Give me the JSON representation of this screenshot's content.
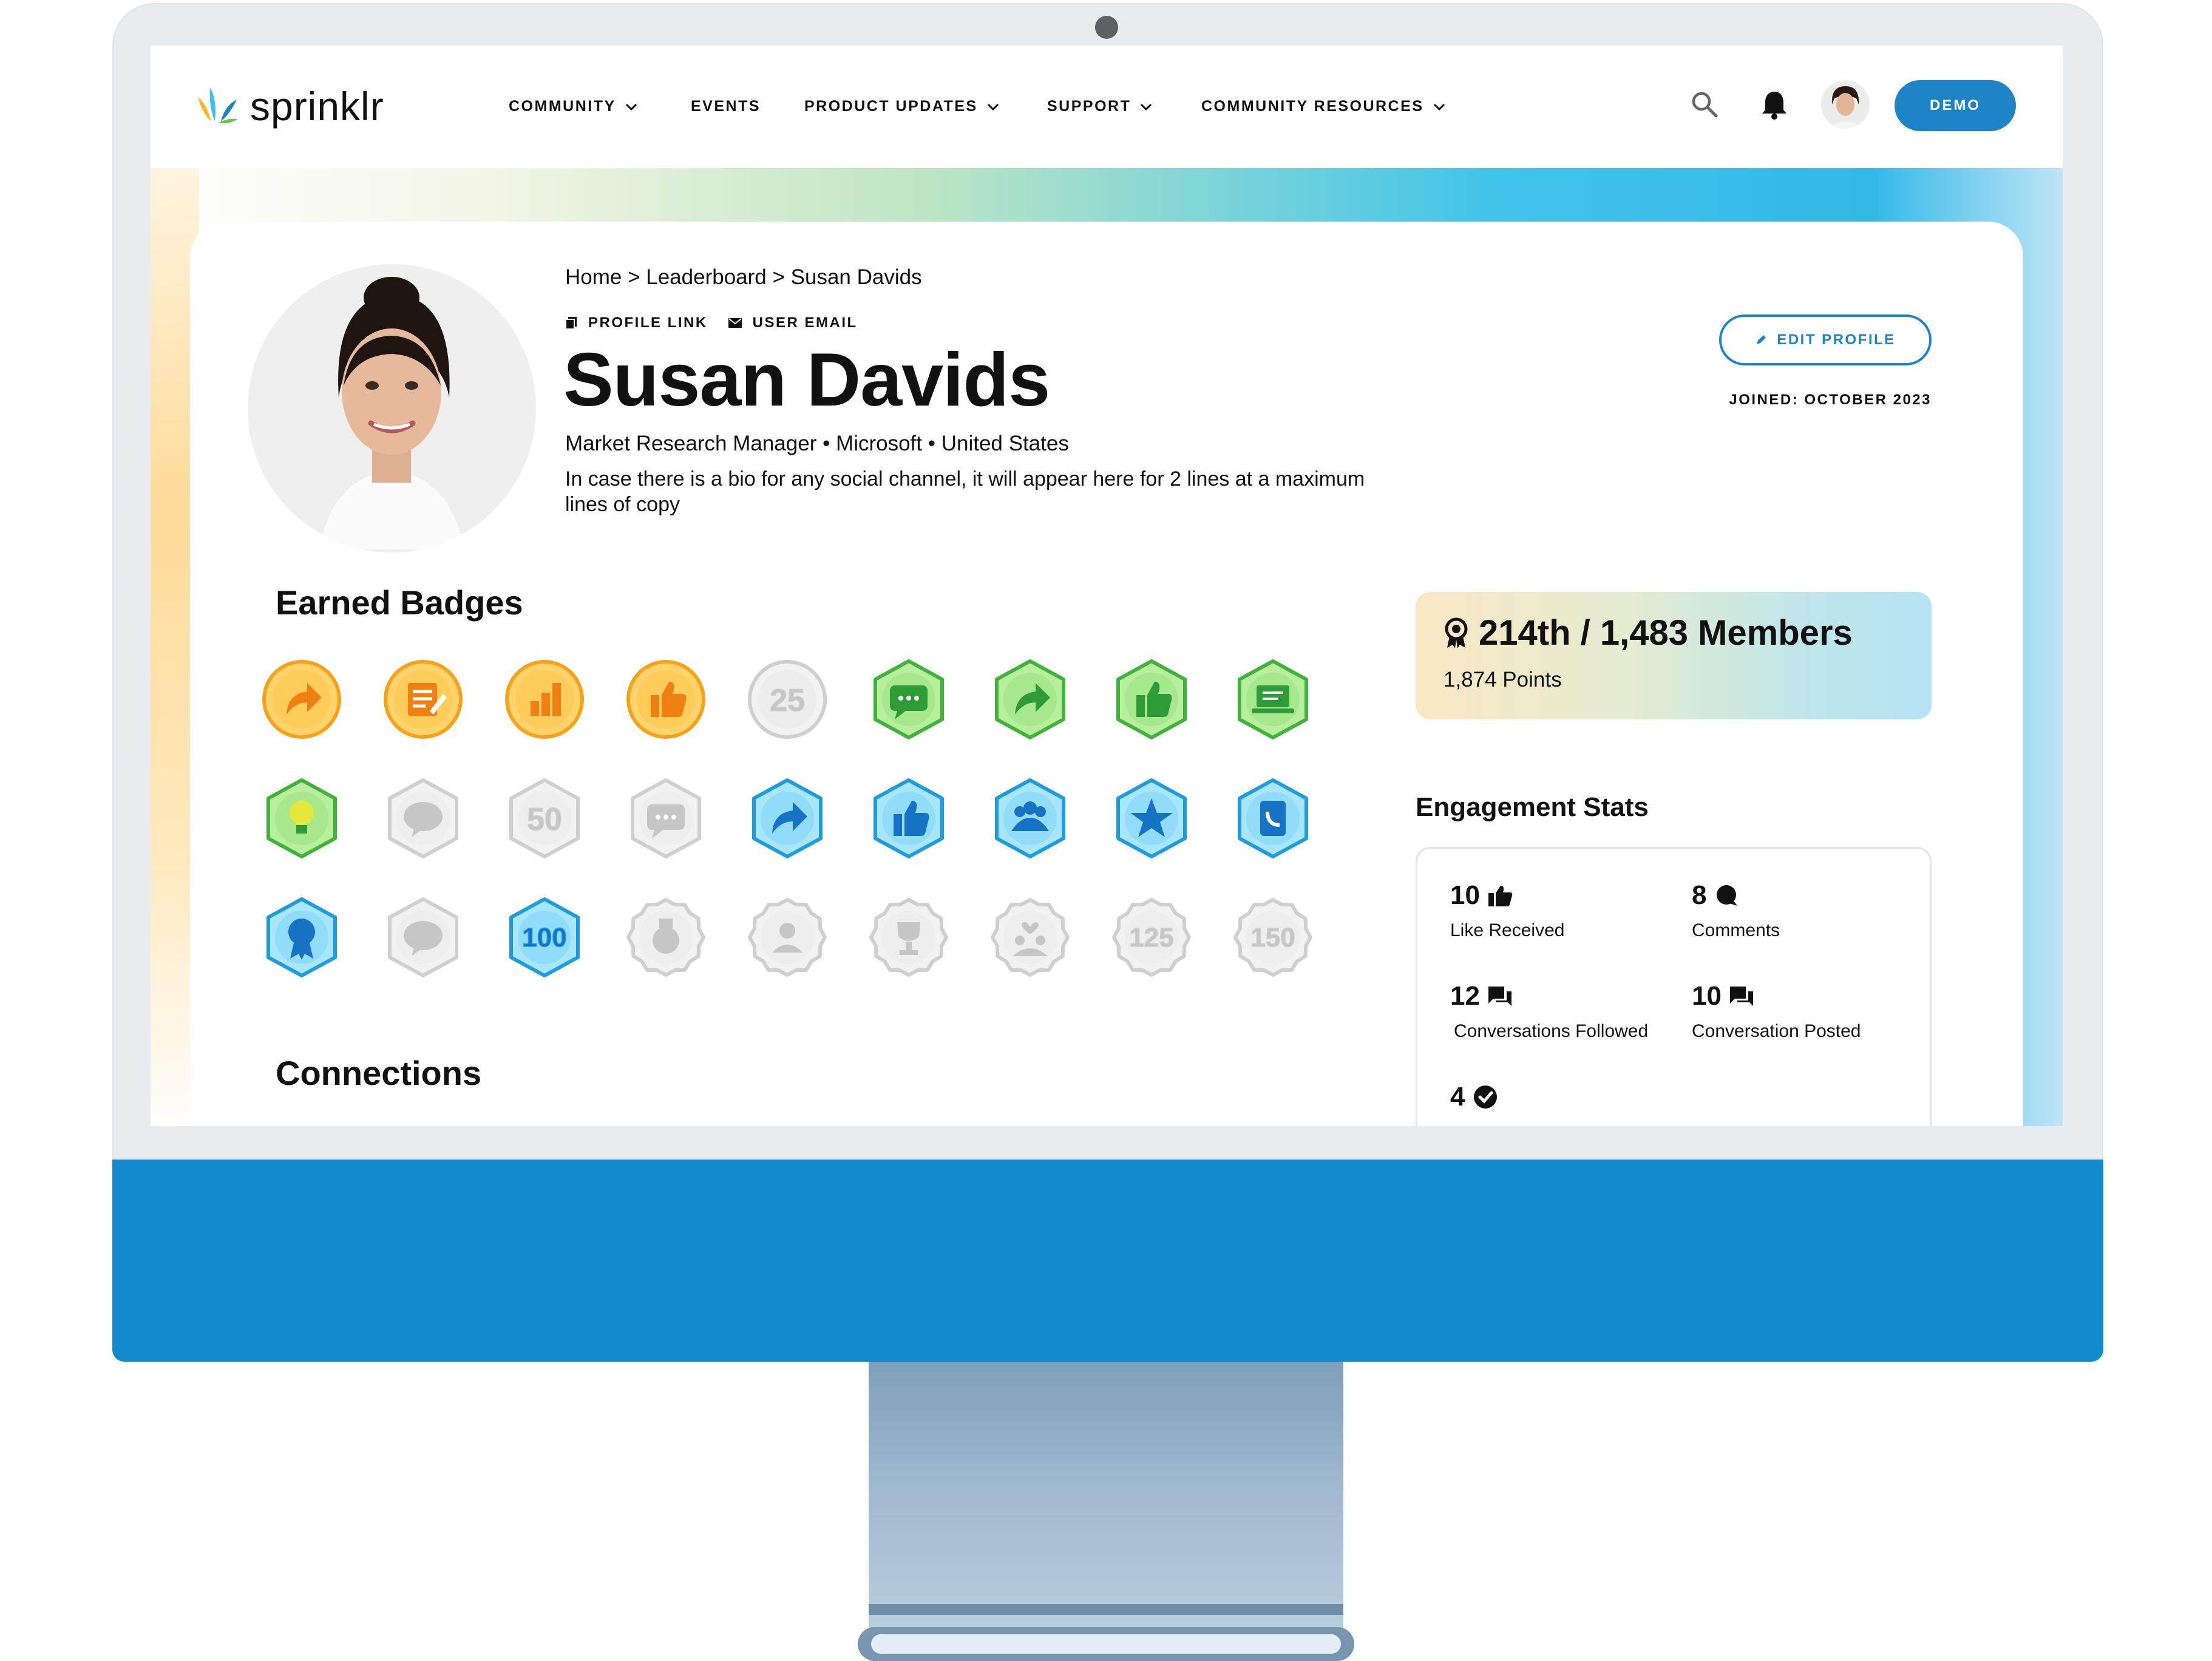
{
  "brand": {
    "name": "sprinklr",
    "accent": "#1d84c7",
    "monitor_chin_color": "#128acd"
  },
  "nav": {
    "items": [
      {
        "label": "COMMUNITY",
        "has_dropdown": true
      },
      {
        "label": "EVENTS",
        "has_dropdown": false
      },
      {
        "label": "PRODUCT UPDATES",
        "has_dropdown": true
      },
      {
        "label": "SUPPORT",
        "has_dropdown": true
      },
      {
        "label": "COMMUNITY RESOURCES",
        "has_dropdown": true
      }
    ],
    "icons": [
      "search-icon",
      "bell-icon",
      "user-avatar"
    ],
    "demo_label": "DEMO"
  },
  "profile": {
    "breadcrumb": "Home > Leaderboard > Susan Davids",
    "profile_link_label": "PROFILE LINK",
    "user_email_label": "USER EMAIL",
    "name": "Susan Davids",
    "meta": "Market Research Manager • Microsoft • United States",
    "bio": "In case there is a bio for any social channel, it will appear here for 2 lines at a maximum lines of copy",
    "edit_label": "EDIT PROFILE",
    "joined": "JOINED: OCTOBER 2023"
  },
  "badges": {
    "title": "Earned Badges",
    "items": [
      {
        "icon": "share-badge",
        "color": "orange",
        "shape": "circle"
      },
      {
        "icon": "note-badge",
        "color": "orange",
        "shape": "circle"
      },
      {
        "icon": "chart-badge",
        "color": "orange",
        "shape": "circle"
      },
      {
        "icon": "thumbs-up-badge",
        "color": "orange",
        "shape": "circle"
      },
      {
        "icon": "number-badge",
        "text": "25",
        "color": "gray",
        "shape": "circle"
      },
      {
        "icon": "chat-badge",
        "color": "green",
        "shape": "hexagon"
      },
      {
        "icon": "share-badge",
        "color": "green",
        "shape": "hexagon"
      },
      {
        "icon": "thumbs-up-badge",
        "color": "green",
        "shape": "hexagon"
      },
      {
        "icon": "laptop-badge",
        "color": "green",
        "shape": "hexagon"
      },
      {
        "icon": "lightbulb-badge",
        "color": "green",
        "shape": "hexagon"
      },
      {
        "icon": "speech-badge",
        "color": "gray",
        "shape": "hexagon"
      },
      {
        "icon": "number-badge",
        "text": "50",
        "color": "gray",
        "shape": "hexagon"
      },
      {
        "icon": "chat-badge",
        "color": "gray",
        "shape": "hexagon"
      },
      {
        "icon": "share-badge",
        "color": "blue",
        "shape": "hexagon"
      },
      {
        "icon": "thumbs-up-badge",
        "color": "blue",
        "shape": "hexagon"
      },
      {
        "icon": "team-badge",
        "color": "blue",
        "shape": "hexagon"
      },
      {
        "icon": "star-badge",
        "color": "blue",
        "shape": "hexagon"
      },
      {
        "icon": "phone-badge",
        "color": "blue",
        "shape": "hexagon"
      },
      {
        "icon": "award-badge",
        "color": "blue",
        "shape": "hexagon"
      },
      {
        "icon": "speech-badge",
        "color": "gray",
        "shape": "hexagon"
      },
      {
        "icon": "number-badge",
        "text": "100",
        "color": "blue",
        "shape": "hexagon"
      },
      {
        "icon": "medal-badge",
        "color": "gray",
        "shape": "octagon"
      },
      {
        "icon": "person-badge",
        "color": "gray",
        "shape": "octagon"
      },
      {
        "icon": "trophy-badge",
        "color": "gray",
        "shape": "octagon"
      },
      {
        "icon": "group-heart-badge",
        "color": "gray",
        "shape": "octagon"
      },
      {
        "icon": "number-badge",
        "text": "125",
        "color": "gray",
        "shape": "octagon"
      },
      {
        "icon": "number-badge",
        "text": "150",
        "color": "gray",
        "shape": "octagon"
      }
    ]
  },
  "connections": {
    "title": "Connections"
  },
  "rank": {
    "text": "214th / 1,483 Members",
    "points": "1,874 Points"
  },
  "engagement": {
    "title": "Engagement Stats",
    "stats": [
      {
        "value": "10",
        "label": "Like Received",
        "icon": "thumbs-up-icon"
      },
      {
        "value": "8",
        "label": "Comments",
        "icon": "comment-icon"
      },
      {
        "value": "12",
        "label": "Conversations Followed",
        "icon": "conversation-icon"
      },
      {
        "value": "10",
        "label": "Conversation Posted",
        "icon": "conversation-icon"
      },
      {
        "value": "4",
        "label": "",
        "icon": "check-circle-icon"
      }
    ]
  }
}
